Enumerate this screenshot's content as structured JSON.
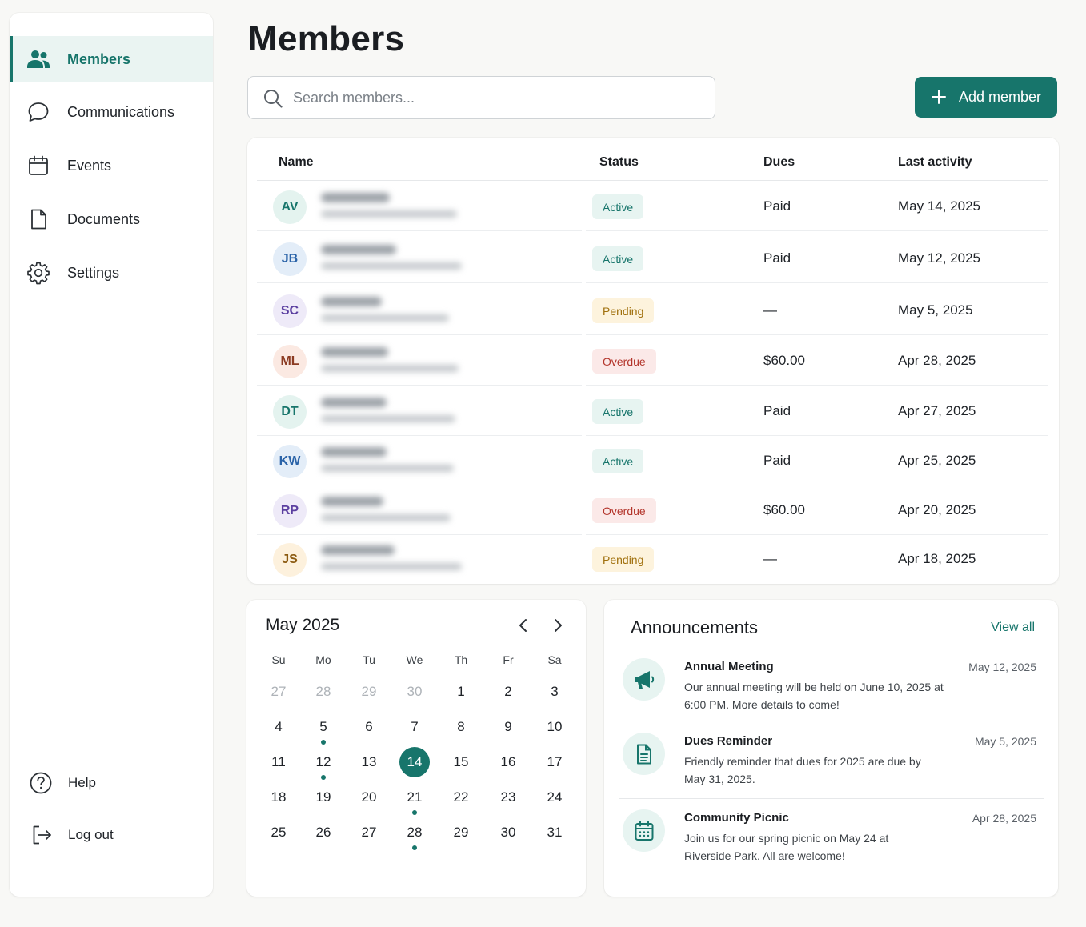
{
  "sidebar": {
    "items": [
      {
        "label": "Members",
        "icon": "users-icon",
        "active": true
      },
      {
        "label": "Communications",
        "icon": "chat-bubble-icon"
      },
      {
        "label": "Events",
        "icon": "calendar-icon"
      },
      {
        "label": "Documents",
        "icon": "document-icon"
      },
      {
        "label": "Settings",
        "icon": "gear-icon"
      }
    ],
    "bottom": [
      {
        "label": "Help",
        "icon": "help-circle-icon"
      },
      {
        "label": "Log out",
        "icon": "logout-icon"
      }
    ]
  },
  "header": {
    "title": "Members",
    "search_placeholder": "Search members...",
    "add_button": "Add member"
  },
  "colors": {
    "accent": "#17756b",
    "active_badge_bg": "#e7f4f1",
    "pending_badge_bg": "#fdf3dd",
    "overdue_badge_bg": "#fbe9e8"
  },
  "table": {
    "columns": [
      "Name",
      "Status",
      "Dues",
      "Last activity"
    ],
    "rows": [
      {
        "initials": "AV",
        "status": "Active",
        "dues": "Paid",
        "last_activity": "May 14, 2025"
      },
      {
        "initials": "JB",
        "status": "Active",
        "dues": "Paid",
        "last_activity": "May 12, 2025"
      },
      {
        "initials": "SC",
        "status": "Pending",
        "dues": "—",
        "last_activity": "May 5, 2025"
      },
      {
        "initials": "ML",
        "status": "Overdue",
        "dues": "$60.00",
        "last_activity": "Apr 28, 2025"
      },
      {
        "initials": "DT",
        "status": "Active",
        "dues": "Paid",
        "last_activity": "Apr 27, 2025"
      },
      {
        "initials": "KW",
        "status": "Active",
        "dues": "Paid",
        "last_activity": "Apr 25, 2025"
      },
      {
        "initials": "RP",
        "status": "Overdue",
        "dues": "$60.00",
        "last_activity": "Apr 20, 2025"
      },
      {
        "initials": "JS",
        "status": "Pending",
        "dues": "—",
        "last_activity": "Apr 18, 2025"
      }
    ]
  },
  "calendar": {
    "title": "May 2025",
    "weekdays": [
      "Su",
      "Mo",
      "Tu",
      "We",
      "Th",
      "Fr",
      "Sa"
    ],
    "weeks": [
      [
        "27",
        "28",
        "29",
        "30",
        "1",
        "2",
        "3"
      ],
      [
        "4",
        "5",
        "6",
        "7",
        "8",
        "9",
        "10"
      ],
      [
        "11",
        "12",
        "13",
        "14",
        "15",
        "16",
        "17"
      ],
      [
        "18",
        "19",
        "20",
        "21",
        "22",
        "23",
        "24"
      ],
      [
        "25",
        "26",
        "27",
        "28",
        "29",
        "30",
        "31"
      ]
    ],
    "today": "14",
    "event_days": [
      "5",
      "12",
      "21",
      "28"
    ]
  },
  "announcements": {
    "title": "Announcements",
    "view_all": "View all",
    "items": [
      {
        "title": "Annual Meeting",
        "date": "May 12, 2025",
        "body": "Our annual meeting will be held on June 10, 2025 at 6:00 PM. More details to come!",
        "icon": "megaphone-icon"
      },
      {
        "title": "Dues Reminder",
        "date": "May 5, 2025",
        "body": "Friendly reminder that dues for 2025 are due by May 31, 2025.",
        "icon": "document-icon"
      },
      {
        "title": "Community Picnic",
        "date": "Apr 28, 2025",
        "body": "Join us for our spring picnic on May 24 at Riverside Park. All are welcome!",
        "icon": "calendar-icon"
      }
    ]
  }
}
